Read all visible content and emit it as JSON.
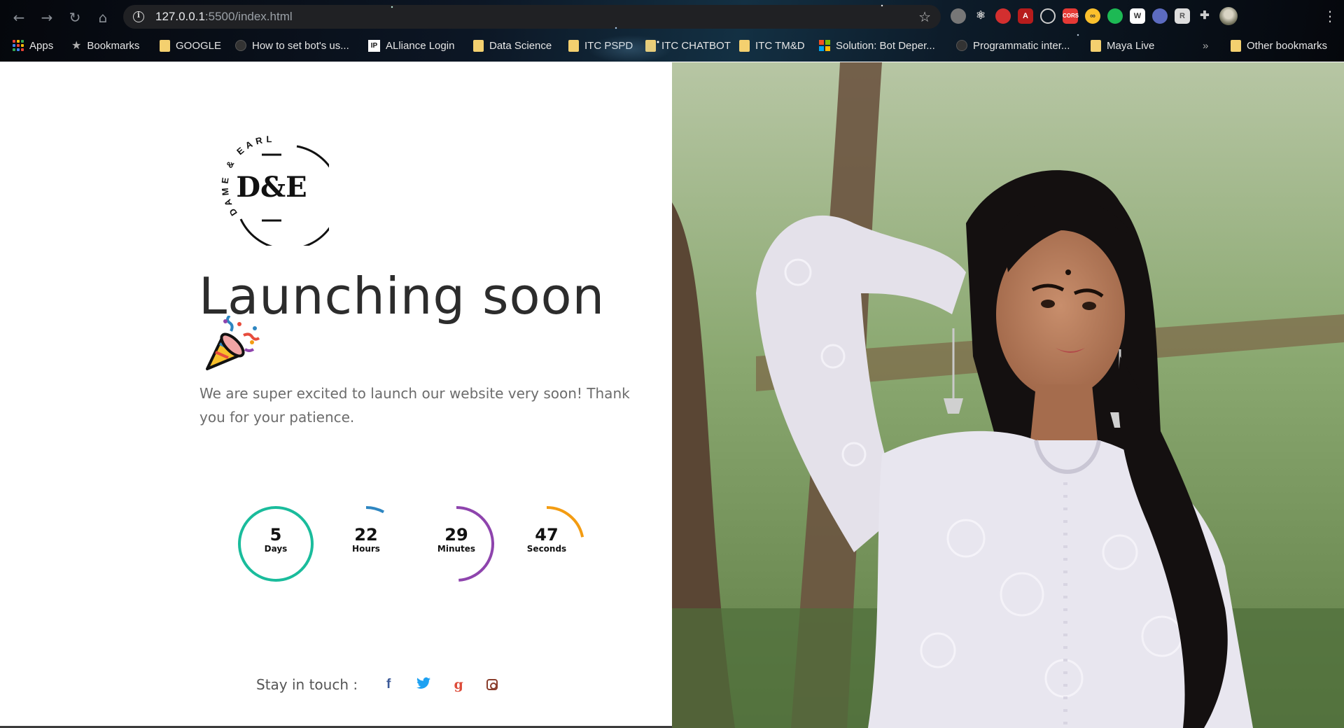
{
  "browser": {
    "url_host": "127.0.0.1",
    "url_path": ":5500/index.html",
    "nav": {
      "back_icon": "arrow-left-icon",
      "forward_icon": "arrow-right-icon",
      "reload_icon": "reload-icon",
      "home_icon": "home-icon"
    },
    "bookmarks": [
      {
        "label": "Apps",
        "icon": "apps-grid-icon"
      },
      {
        "label": "Bookmarks",
        "icon": "star-icon"
      },
      {
        "label": "GOOGLE",
        "icon": "folder-icon"
      },
      {
        "label": "How to set bot's us...",
        "icon": "favicon-icon"
      },
      {
        "label": "ALliance Login",
        "icon": "ip-favicon-icon"
      },
      {
        "label": "Data Science",
        "icon": "folder-icon"
      },
      {
        "label": "ITC PSPD",
        "icon": "folder-icon"
      },
      {
        "label": "ITC CHATBOT",
        "icon": "folder-icon"
      },
      {
        "label": "ITC TM&D",
        "icon": "folder-icon"
      },
      {
        "label": "Solution: Bot Deper...",
        "icon": "microsoft-favicon-icon"
      },
      {
        "label": "Programmatic inter...",
        "icon": "favicon-icon"
      },
      {
        "label": "Maya Live",
        "icon": "folder-icon"
      },
      {
        "label": "»",
        "icon": "overflow-icon"
      },
      {
        "label": "Other bookmarks",
        "icon": "folder-icon"
      }
    ]
  },
  "logo": {
    "monogram": "D&E",
    "arc_text": "DAME & EARL"
  },
  "headline": "Launching soon",
  "tagline": "We are super excited to launch our website very soon! Thank you for your patience.",
  "countdown": [
    {
      "value": "5",
      "label": "Days",
      "color": "#1abc9c",
      "progress": 1.0
    },
    {
      "value": "22",
      "label": "Hours",
      "color": "#2e86c1",
      "progress": 0.08
    },
    {
      "value": "29",
      "label": "Minutes",
      "color": "#8e44ad",
      "progress": 0.49
    },
    {
      "value": "47",
      "label": "Seconds",
      "color": "#f39c12",
      "progress": 0.22
    }
  ],
  "social": {
    "label": "Stay in touch :",
    "facebook": "f",
    "twitter_icon": "twitter-icon",
    "google": "g",
    "instagram_icon": "instagram-icon"
  }
}
